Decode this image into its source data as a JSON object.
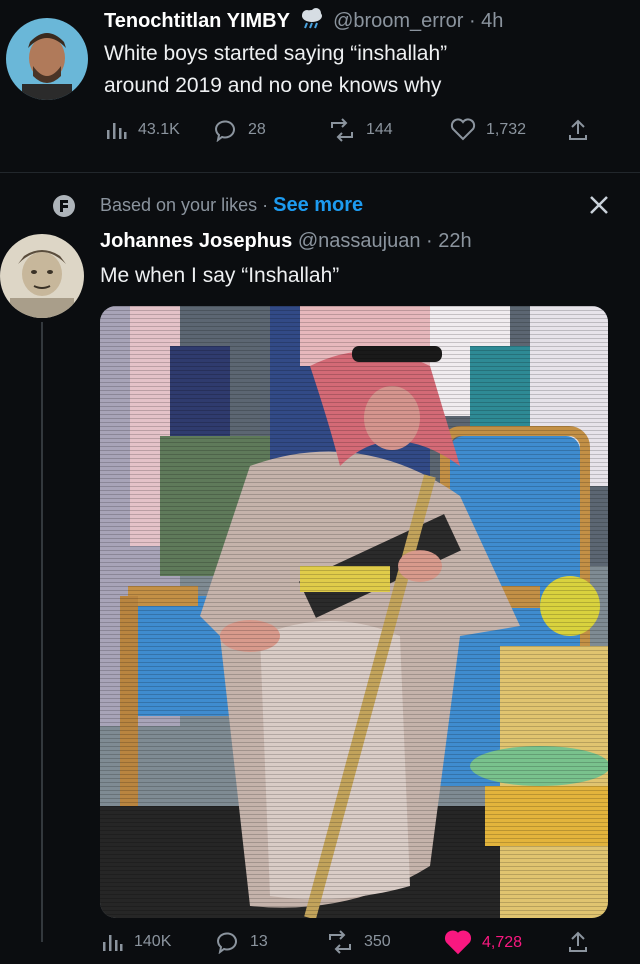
{
  "tweet1": {
    "name": "Tenochtitlan YIMBY",
    "handle": "@broom_error",
    "time": "· 4h",
    "text_line1": "White boys started saying “inshallah”",
    "text_line2": "around 2019 and no one knows why",
    "views": "43.1K",
    "replies": "28",
    "retweets": "144",
    "likes": "1,732"
  },
  "context": {
    "label": "Based on your likes",
    "dot": "·",
    "see_more": "See more"
  },
  "tweet2": {
    "name": "Johannes Josephus",
    "handle": "@nassaujuan",
    "time": "· 22h",
    "text": "Me when I say “Inshallah”",
    "views": "140K",
    "replies": "13",
    "retweets": "350",
    "likes": "4,728",
    "liked": true
  },
  "colors": {
    "background": "#0b0d10",
    "accent": "#1d9bf0",
    "like": "#f91880",
    "muted": "#8b949e"
  },
  "icons": [
    "views-icon",
    "reply-icon",
    "retweet-icon",
    "like-icon",
    "share-icon",
    "close-icon",
    "sparkle-icon",
    "cloud-icon"
  ]
}
